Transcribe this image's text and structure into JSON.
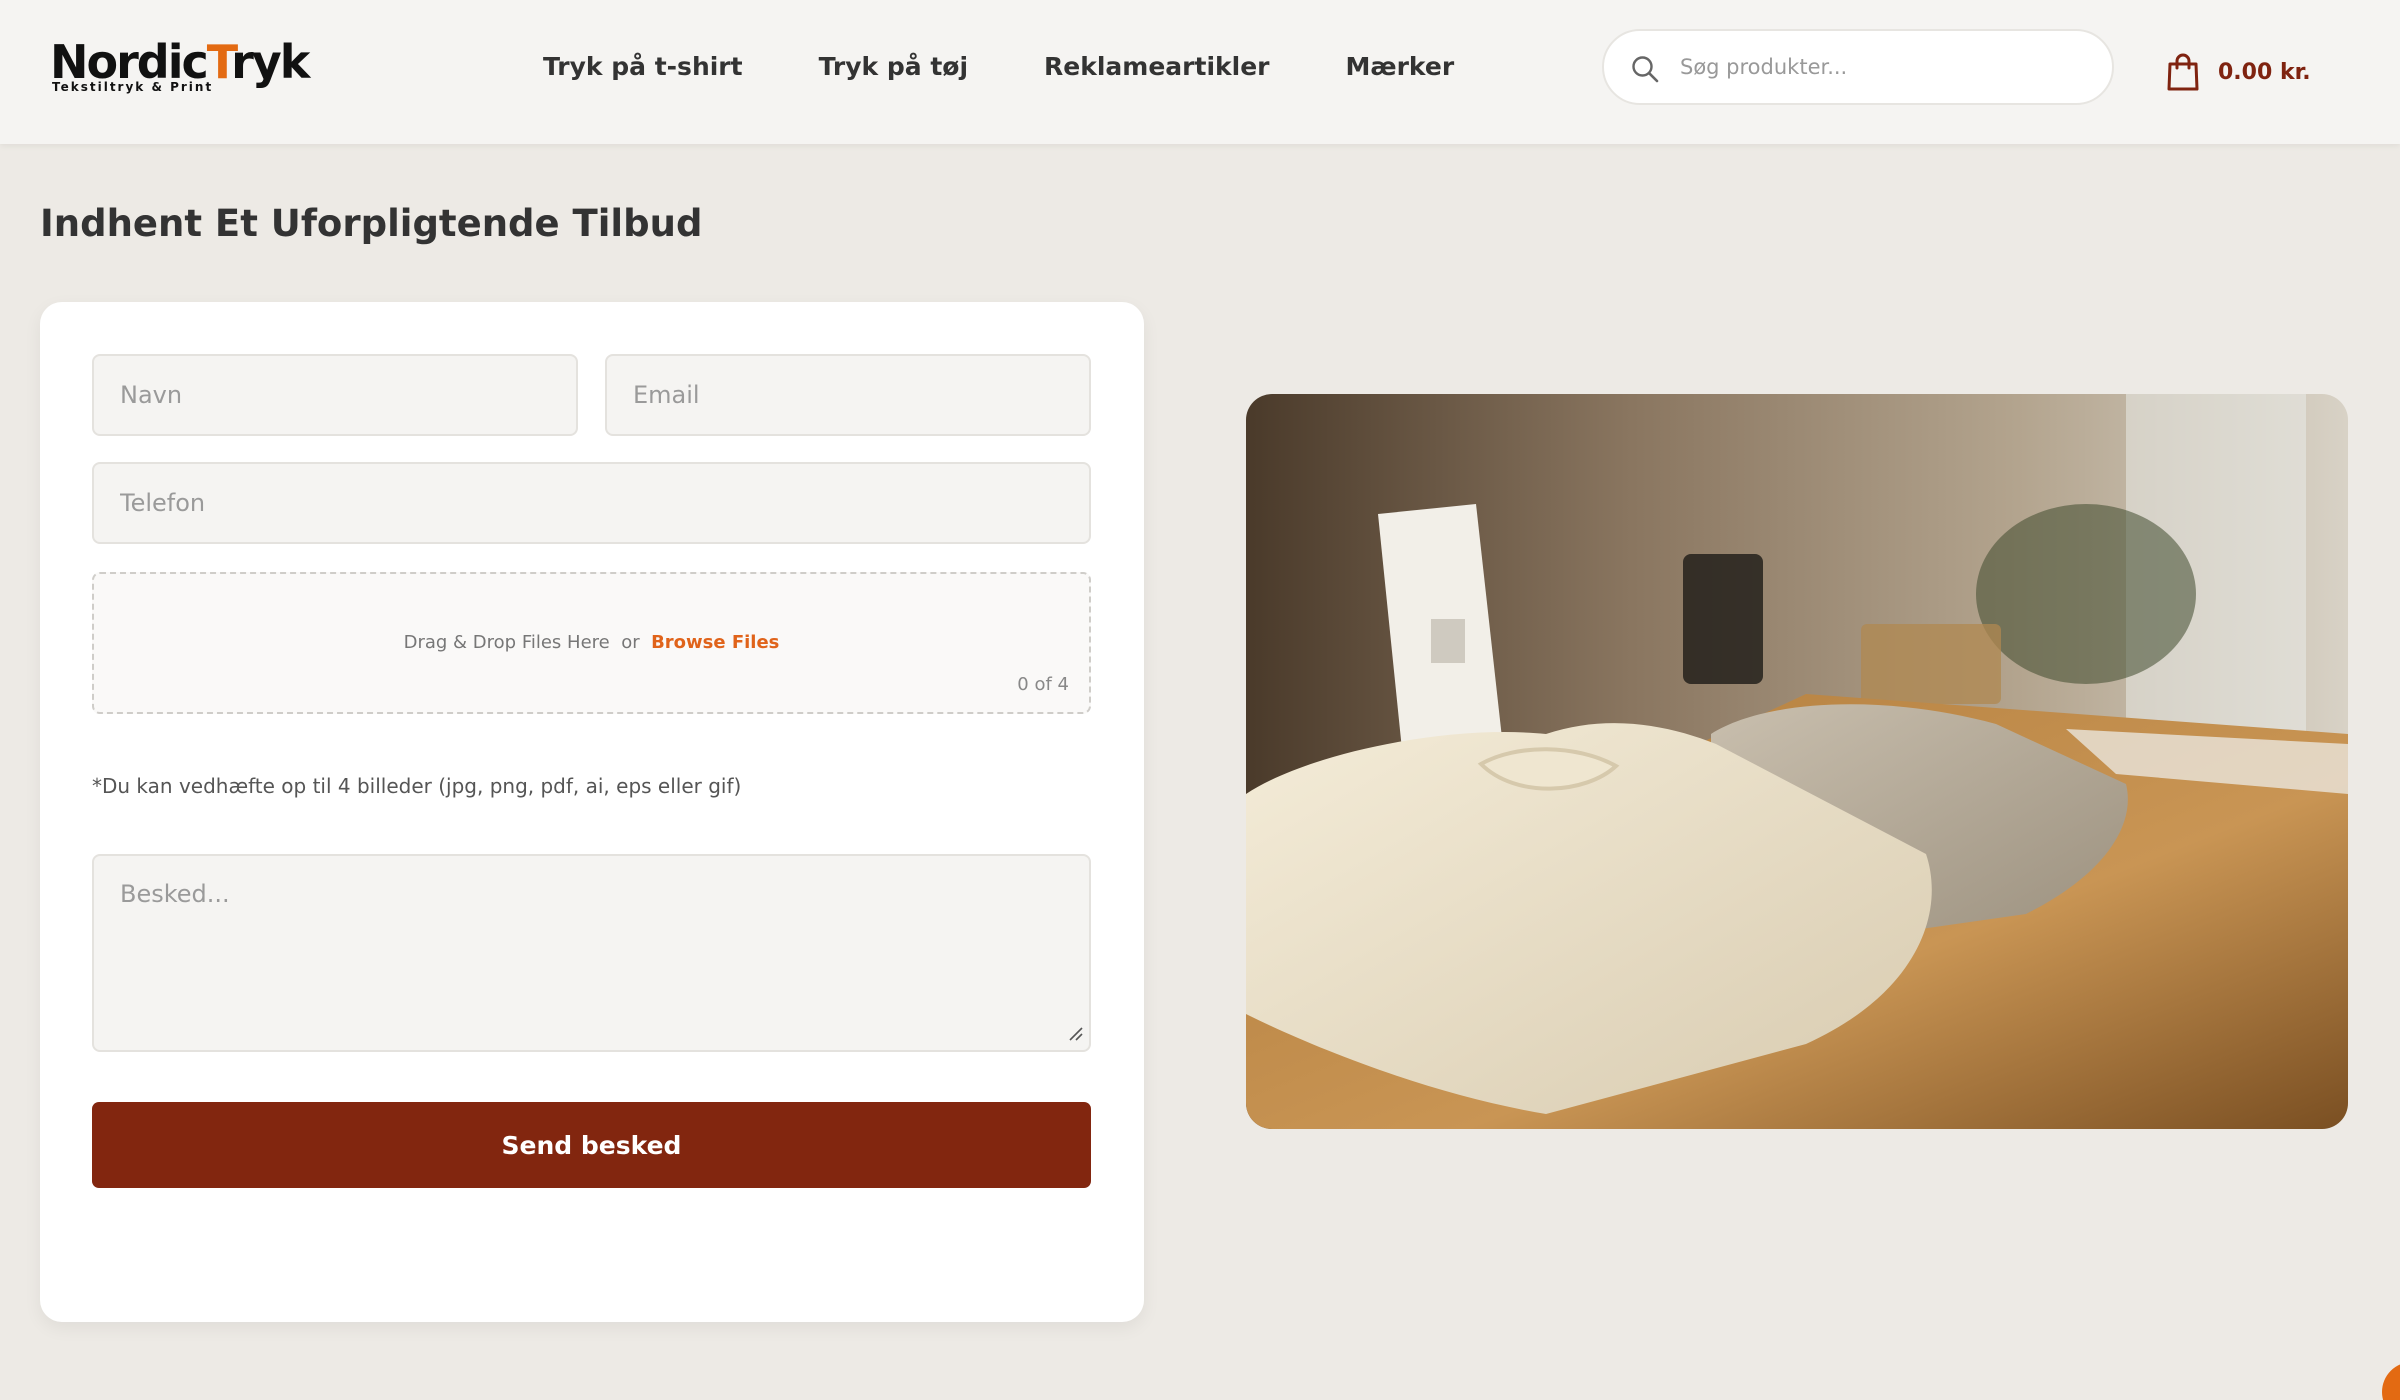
{
  "header": {
    "logo": {
      "main_prefix": "Nordic",
      "main_accent": "T",
      "main_suffix": "ryk",
      "tagline": "Tekstiltryk & Print"
    },
    "nav": [
      {
        "label": "Tryk på t-shirt"
      },
      {
        "label": "Tryk på tøj"
      },
      {
        "label": "Reklameartikler"
      },
      {
        "label": "Mærker"
      }
    ],
    "search": {
      "placeholder": "Søg produkter..."
    },
    "cart": {
      "total": "0.00 kr."
    }
  },
  "page": {
    "title": "Indhent Et Uforpligtende Tilbud"
  },
  "form": {
    "name_placeholder": "Navn",
    "email_placeholder": "Email",
    "phone_placeholder": "Telefon",
    "dropzone": {
      "text": "Drag & Drop Files Here",
      "or": "or",
      "browse": "Browse Files",
      "count": "0 of 4"
    },
    "hint": "*Du kan vedhæfte op til 4 billeder (jpg, png, pdf, ai, eps eller gif)",
    "message_placeholder": "Besked...",
    "submit_label": "Send besked"
  },
  "colors": {
    "accent": "#e36a12",
    "primary": "#82260f",
    "background": "#edeae5"
  },
  "icons": {
    "search": "search-icon",
    "cart": "shopping-bag-icon"
  }
}
